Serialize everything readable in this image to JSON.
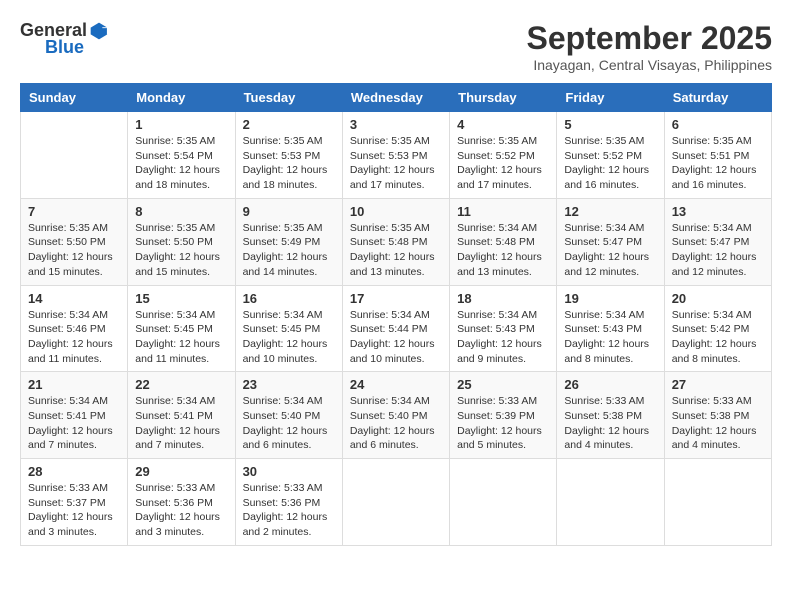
{
  "header": {
    "logo_general": "General",
    "logo_blue": "Blue",
    "month_year": "September 2025",
    "location": "Inayagan, Central Visayas, Philippines"
  },
  "weekdays": [
    "Sunday",
    "Monday",
    "Tuesday",
    "Wednesday",
    "Thursday",
    "Friday",
    "Saturday"
  ],
  "weeks": [
    [
      {
        "day": "",
        "info": ""
      },
      {
        "day": "1",
        "info": "Sunrise: 5:35 AM\nSunset: 5:54 PM\nDaylight: 12 hours\nand 18 minutes."
      },
      {
        "day": "2",
        "info": "Sunrise: 5:35 AM\nSunset: 5:53 PM\nDaylight: 12 hours\nand 18 minutes."
      },
      {
        "day": "3",
        "info": "Sunrise: 5:35 AM\nSunset: 5:53 PM\nDaylight: 12 hours\nand 17 minutes."
      },
      {
        "day": "4",
        "info": "Sunrise: 5:35 AM\nSunset: 5:52 PM\nDaylight: 12 hours\nand 17 minutes."
      },
      {
        "day": "5",
        "info": "Sunrise: 5:35 AM\nSunset: 5:52 PM\nDaylight: 12 hours\nand 16 minutes."
      },
      {
        "day": "6",
        "info": "Sunrise: 5:35 AM\nSunset: 5:51 PM\nDaylight: 12 hours\nand 16 minutes."
      }
    ],
    [
      {
        "day": "7",
        "info": "Sunrise: 5:35 AM\nSunset: 5:50 PM\nDaylight: 12 hours\nand 15 minutes."
      },
      {
        "day": "8",
        "info": "Sunrise: 5:35 AM\nSunset: 5:50 PM\nDaylight: 12 hours\nand 15 minutes."
      },
      {
        "day": "9",
        "info": "Sunrise: 5:35 AM\nSunset: 5:49 PM\nDaylight: 12 hours\nand 14 minutes."
      },
      {
        "day": "10",
        "info": "Sunrise: 5:35 AM\nSunset: 5:48 PM\nDaylight: 12 hours\nand 13 minutes."
      },
      {
        "day": "11",
        "info": "Sunrise: 5:34 AM\nSunset: 5:48 PM\nDaylight: 12 hours\nand 13 minutes."
      },
      {
        "day": "12",
        "info": "Sunrise: 5:34 AM\nSunset: 5:47 PM\nDaylight: 12 hours\nand 12 minutes."
      },
      {
        "day": "13",
        "info": "Sunrise: 5:34 AM\nSunset: 5:47 PM\nDaylight: 12 hours\nand 12 minutes."
      }
    ],
    [
      {
        "day": "14",
        "info": "Sunrise: 5:34 AM\nSunset: 5:46 PM\nDaylight: 12 hours\nand 11 minutes."
      },
      {
        "day": "15",
        "info": "Sunrise: 5:34 AM\nSunset: 5:45 PM\nDaylight: 12 hours\nand 11 minutes."
      },
      {
        "day": "16",
        "info": "Sunrise: 5:34 AM\nSunset: 5:45 PM\nDaylight: 12 hours\nand 10 minutes."
      },
      {
        "day": "17",
        "info": "Sunrise: 5:34 AM\nSunset: 5:44 PM\nDaylight: 12 hours\nand 10 minutes."
      },
      {
        "day": "18",
        "info": "Sunrise: 5:34 AM\nSunset: 5:43 PM\nDaylight: 12 hours\nand 9 minutes."
      },
      {
        "day": "19",
        "info": "Sunrise: 5:34 AM\nSunset: 5:43 PM\nDaylight: 12 hours\nand 8 minutes."
      },
      {
        "day": "20",
        "info": "Sunrise: 5:34 AM\nSunset: 5:42 PM\nDaylight: 12 hours\nand 8 minutes."
      }
    ],
    [
      {
        "day": "21",
        "info": "Sunrise: 5:34 AM\nSunset: 5:41 PM\nDaylight: 12 hours\nand 7 minutes."
      },
      {
        "day": "22",
        "info": "Sunrise: 5:34 AM\nSunset: 5:41 PM\nDaylight: 12 hours\nand 7 minutes."
      },
      {
        "day": "23",
        "info": "Sunrise: 5:34 AM\nSunset: 5:40 PM\nDaylight: 12 hours\nand 6 minutes."
      },
      {
        "day": "24",
        "info": "Sunrise: 5:34 AM\nSunset: 5:40 PM\nDaylight: 12 hours\nand 6 minutes."
      },
      {
        "day": "25",
        "info": "Sunrise: 5:33 AM\nSunset: 5:39 PM\nDaylight: 12 hours\nand 5 minutes."
      },
      {
        "day": "26",
        "info": "Sunrise: 5:33 AM\nSunset: 5:38 PM\nDaylight: 12 hours\nand 4 minutes."
      },
      {
        "day": "27",
        "info": "Sunrise: 5:33 AM\nSunset: 5:38 PM\nDaylight: 12 hours\nand 4 minutes."
      }
    ],
    [
      {
        "day": "28",
        "info": "Sunrise: 5:33 AM\nSunset: 5:37 PM\nDaylight: 12 hours\nand 3 minutes."
      },
      {
        "day": "29",
        "info": "Sunrise: 5:33 AM\nSunset: 5:36 PM\nDaylight: 12 hours\nand 3 minutes."
      },
      {
        "day": "30",
        "info": "Sunrise: 5:33 AM\nSunset: 5:36 PM\nDaylight: 12 hours\nand 2 minutes."
      },
      {
        "day": "",
        "info": ""
      },
      {
        "day": "",
        "info": ""
      },
      {
        "day": "",
        "info": ""
      },
      {
        "day": "",
        "info": ""
      }
    ]
  ]
}
